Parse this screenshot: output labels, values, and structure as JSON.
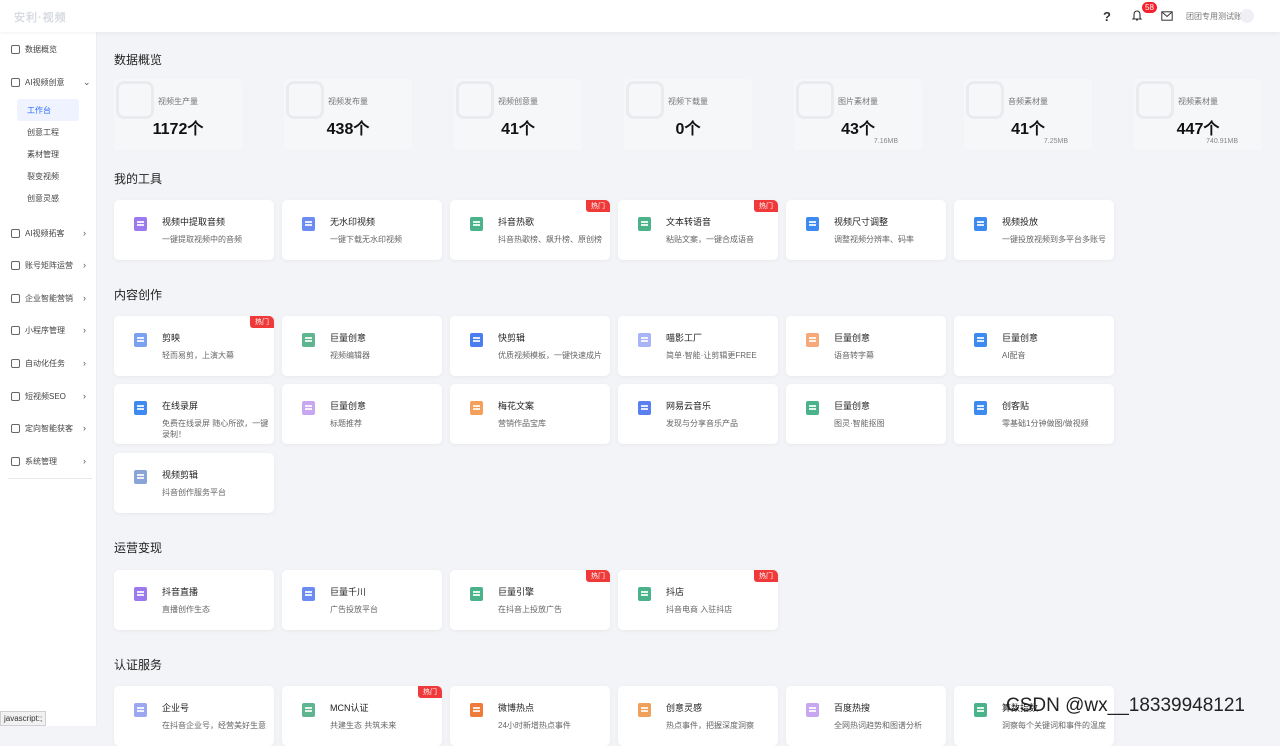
{
  "topbar": {
    "logo": "安利·视频",
    "notification_count": "58",
    "username": "团团专用测试账"
  },
  "sidebar": {
    "items": [
      {
        "label": "数据概览",
        "chevron": ""
      },
      {
        "label": "AI视频创意",
        "chevron": "⌄"
      },
      {
        "label": "AI视频拓客",
        "chevron": "›"
      },
      {
        "label": "账号矩阵运营",
        "chevron": "›"
      },
      {
        "label": "企业智能营销",
        "chevron": "›"
      },
      {
        "label": "小程序管理",
        "chevron": "›"
      },
      {
        "label": "自动化任务",
        "chevron": "›"
      },
      {
        "label": "短视频SEO",
        "chevron": "›"
      },
      {
        "label": "定向智能获客",
        "chevron": "›"
      },
      {
        "label": "系统管理",
        "chevron": "›"
      }
    ],
    "subitems": [
      {
        "label": "工作台"
      },
      {
        "label": "创意工程"
      },
      {
        "label": "素材管理"
      },
      {
        "label": "裂变视频"
      },
      {
        "label": "创意灵感"
      }
    ]
  },
  "sections": {
    "overview": "数据概览",
    "tools": "我的工具",
    "content": "内容创作",
    "ops": "运营变现",
    "cert": "认证服务"
  },
  "stats": [
    {
      "label": "视频生产量",
      "value": "1172个",
      "sub": ""
    },
    {
      "label": "视频发布量",
      "value": "438个",
      "sub": ""
    },
    {
      "label": "视频创意量",
      "value": "41个",
      "sub": ""
    },
    {
      "label": "视频下载量",
      "value": "0个",
      "sub": ""
    },
    {
      "label": "图片素材量",
      "value": "43个",
      "sub": "7.16MB"
    },
    {
      "label": "音频素材量",
      "value": "41个",
      "sub": "7.25MB"
    },
    {
      "label": "视频素材量",
      "value": "447个",
      "sub": "740.91MB"
    }
  ],
  "hot_label": "热门",
  "tools": [
    {
      "title": "视频中提取音频",
      "desc": "一键提取视频中的音频",
      "color": "#9b7af0"
    },
    {
      "title": "无水印视频",
      "desc": "一键下载无水印视频",
      "color": "#6b8cf2"
    },
    {
      "title": "抖音热歌",
      "desc": "抖音热歌榜、飙升榜、原创榜",
      "color": "#4ab38a"
    },
    {
      "title": "文本转语音",
      "desc": "粘贴文案，一键合成语音",
      "color": "#4ab38a"
    },
    {
      "title": "视频尺寸调整",
      "desc": "调整视频分辨率、码率",
      "color": "#3d8bf0"
    },
    {
      "title": "视频投放",
      "desc": "一键投放视频到多平台多账号",
      "color": "#3d8bf0"
    }
  ],
  "content": [
    {
      "title": "剪映",
      "desc": "轻而易剪，上演大幕",
      "color": "#7aa0f2"
    },
    {
      "title": "巨量创意",
      "desc": "视频编辑器",
      "color": "#5fb58f"
    },
    {
      "title": "快剪辑",
      "desc": "优质视频模板，一键快速成片",
      "color": "#4a7ef0"
    },
    {
      "title": "喵影工厂",
      "desc": "简单·智能·让剪辑更FREE",
      "color": "#a8b4f5"
    },
    {
      "title": "巨量创意",
      "desc": "语音转字幕",
      "color": "#f5a97a"
    },
    {
      "title": "巨量创意",
      "desc": "AI配音",
      "color": "#3d8bf0"
    },
    {
      "title": "在线录屏",
      "desc": "免费在线录屏 随心所欲，一键录制！",
      "color": "#3d8bf0"
    },
    {
      "title": "巨量创意",
      "desc": "标题推荐",
      "color": "#c7a7f0"
    },
    {
      "title": "梅花文案",
      "desc": "营销作品宝库",
      "color": "#f5a05a"
    },
    {
      "title": "网易云音乐",
      "desc": "发现与分享音乐产品",
      "color": "#5a7ff0"
    },
    {
      "title": "巨量创意",
      "desc": "图灵·智能抠图",
      "color": "#4ab38a"
    },
    {
      "title": "创客贴",
      "desc": "零基础1分钟做图/做视频",
      "color": "#3d8bf0"
    },
    {
      "title": "视频剪辑",
      "desc": "抖音创作服务平台",
      "color": "#8aa4d8"
    }
  ],
  "ops": [
    {
      "title": "抖音直播",
      "desc": "直播创作生态",
      "color": "#9b7af0"
    },
    {
      "title": "巨量千川",
      "desc": "广告投放平台",
      "color": "#6b8cf2"
    },
    {
      "title": "巨量引擎",
      "desc": "在抖音上投放广告",
      "color": "#4ab38a"
    },
    {
      "title": "抖店",
      "desc": "抖音电商 入驻抖店",
      "color": "#4ab38a"
    }
  ],
  "cert": [
    {
      "title": "企业号",
      "desc": "在抖音企业号，经营美好生意",
      "color": "#9ba7f0"
    },
    {
      "title": "MCN认证",
      "desc": "共建生态 共筑未来",
      "color": "#5fb58f"
    },
    {
      "title": "微博热点",
      "desc": "24小时新增热点事件",
      "color": "#f07a3a"
    },
    {
      "title": "创意灵感",
      "desc": "热点事件，把握深度洞察",
      "color": "#f0a05a"
    },
    {
      "title": "百度热搜",
      "desc": "全网热词趋势和图谱分析",
      "color": "#c7a7f0"
    },
    {
      "title": "算数指数",
      "desc": "洞察每个关键词和事件的温度",
      "color": "#4ab38a"
    }
  ],
  "watermark": "CSDN @wx__18339948121",
  "status_url": "javascript:;"
}
